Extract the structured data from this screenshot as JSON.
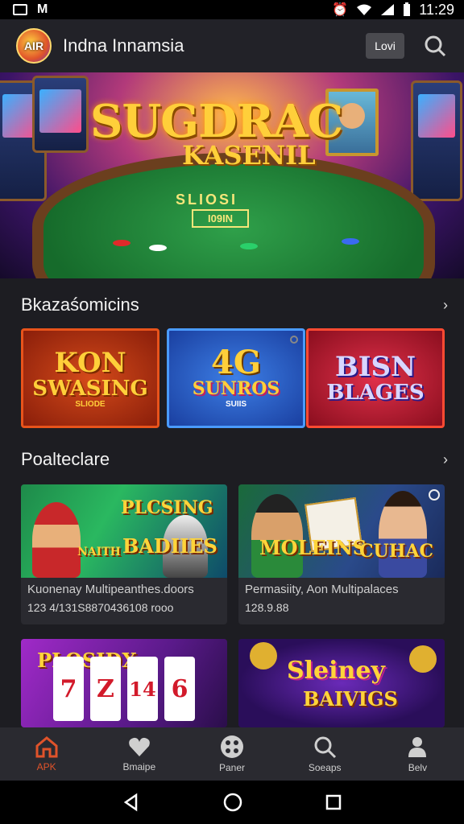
{
  "status_bar": {
    "time": "11:29",
    "left_glyph": "M"
  },
  "app_bar": {
    "logo_text": "AIR",
    "title": "Indna Innamsia",
    "login_label": "Lovi"
  },
  "hero": {
    "title": "SUGDRAC",
    "subtitle": "KASENIL",
    "felt_text": "SLIOSI",
    "felt_box": "I09IN"
  },
  "section_1": {
    "title": "Bkazaśomicins",
    "tiles": [
      {
        "line1": "KON",
        "line2": "SWASING",
        "line3": "SLIODE"
      },
      {
        "line1": "4G",
        "line2": "SUNROS",
        "line3": "SUIIS"
      },
      {
        "line1": "BISN",
        "line2": "BLAGES",
        "line3": ""
      }
    ]
  },
  "section_2": {
    "title": "Poalteclare",
    "cards": [
      {
        "art_line1": "PLCSING",
        "art_line2": "BADIIES",
        "art_line3": "NAITH",
        "name": "Kuonenay Multipeanthes.doors",
        "number": "123 4/131S8870436108 rooo"
      },
      {
        "art_line1": "MOLEINS",
        "art_line2": "CUHAC",
        "art_line3": "",
        "name": "Permasiity, Aon Multipalaces",
        "number": "128.9.88"
      },
      {
        "art_line1": "PLOSIDX",
        "reels": [
          "7",
          "Z",
          "14",
          "6"
        ]
      },
      {
        "art_line1": "Sleiney",
        "art_line2": "BAIVIGS"
      }
    ]
  },
  "bottom_nav": [
    {
      "label": "APK",
      "icon": "home-icon",
      "active": true
    },
    {
      "label": "Bmaipe",
      "icon": "heart-icon",
      "active": false
    },
    {
      "label": "Paner",
      "icon": "grid-icon",
      "active": false
    },
    {
      "label": "Soeaps",
      "icon": "search-icon",
      "active": false
    },
    {
      "label": "Belv",
      "icon": "user-icon",
      "active": false
    }
  ],
  "colors": {
    "accent": "#e0532a",
    "background": "#1d1d22",
    "gold": "#ffcf3a"
  }
}
